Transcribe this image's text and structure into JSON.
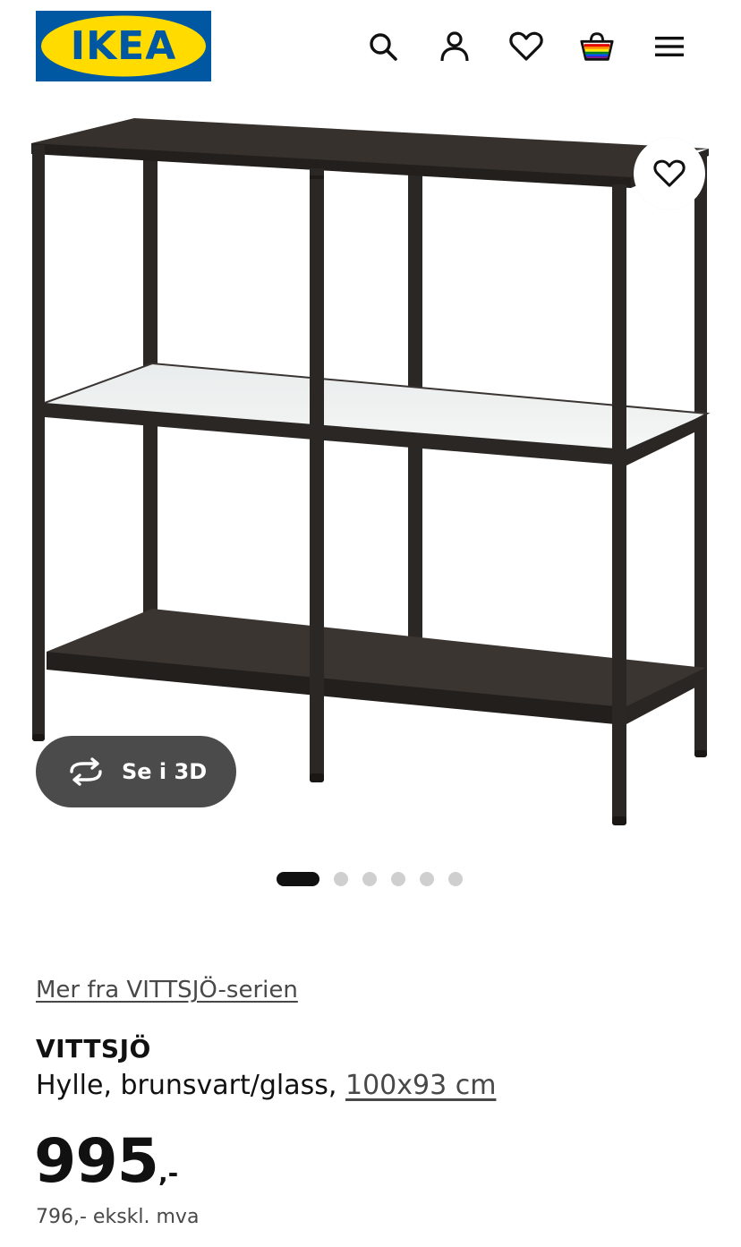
{
  "header": {
    "logo_text": "IKEA",
    "icons": [
      "search-icon",
      "account-icon",
      "heart-icon",
      "shopping-bag-icon",
      "menu-icon"
    ]
  },
  "hero": {
    "see_3d_label": "Se i 3D",
    "carousel_dot_count": 6,
    "carousel_active_index": 0
  },
  "product": {
    "series_link": "Mer fra VITTSJÖ-serien",
    "name": "VITTSJÖ",
    "description_prefix": "Hylle, brunsvart/glass, ",
    "size": "100x93 cm",
    "price_amount": "995",
    "price_suffix": ",-",
    "price_excl_vat": "796,- ekskl. mva"
  },
  "colors": {
    "ikea_blue": "#0058a3",
    "ikea_yellow": "#ffdb00",
    "shelf_frame": "#2b2724",
    "button_dark": "#4b4b4b",
    "dot_active": "#111111",
    "dot_inactive": "#cfcfcf"
  }
}
